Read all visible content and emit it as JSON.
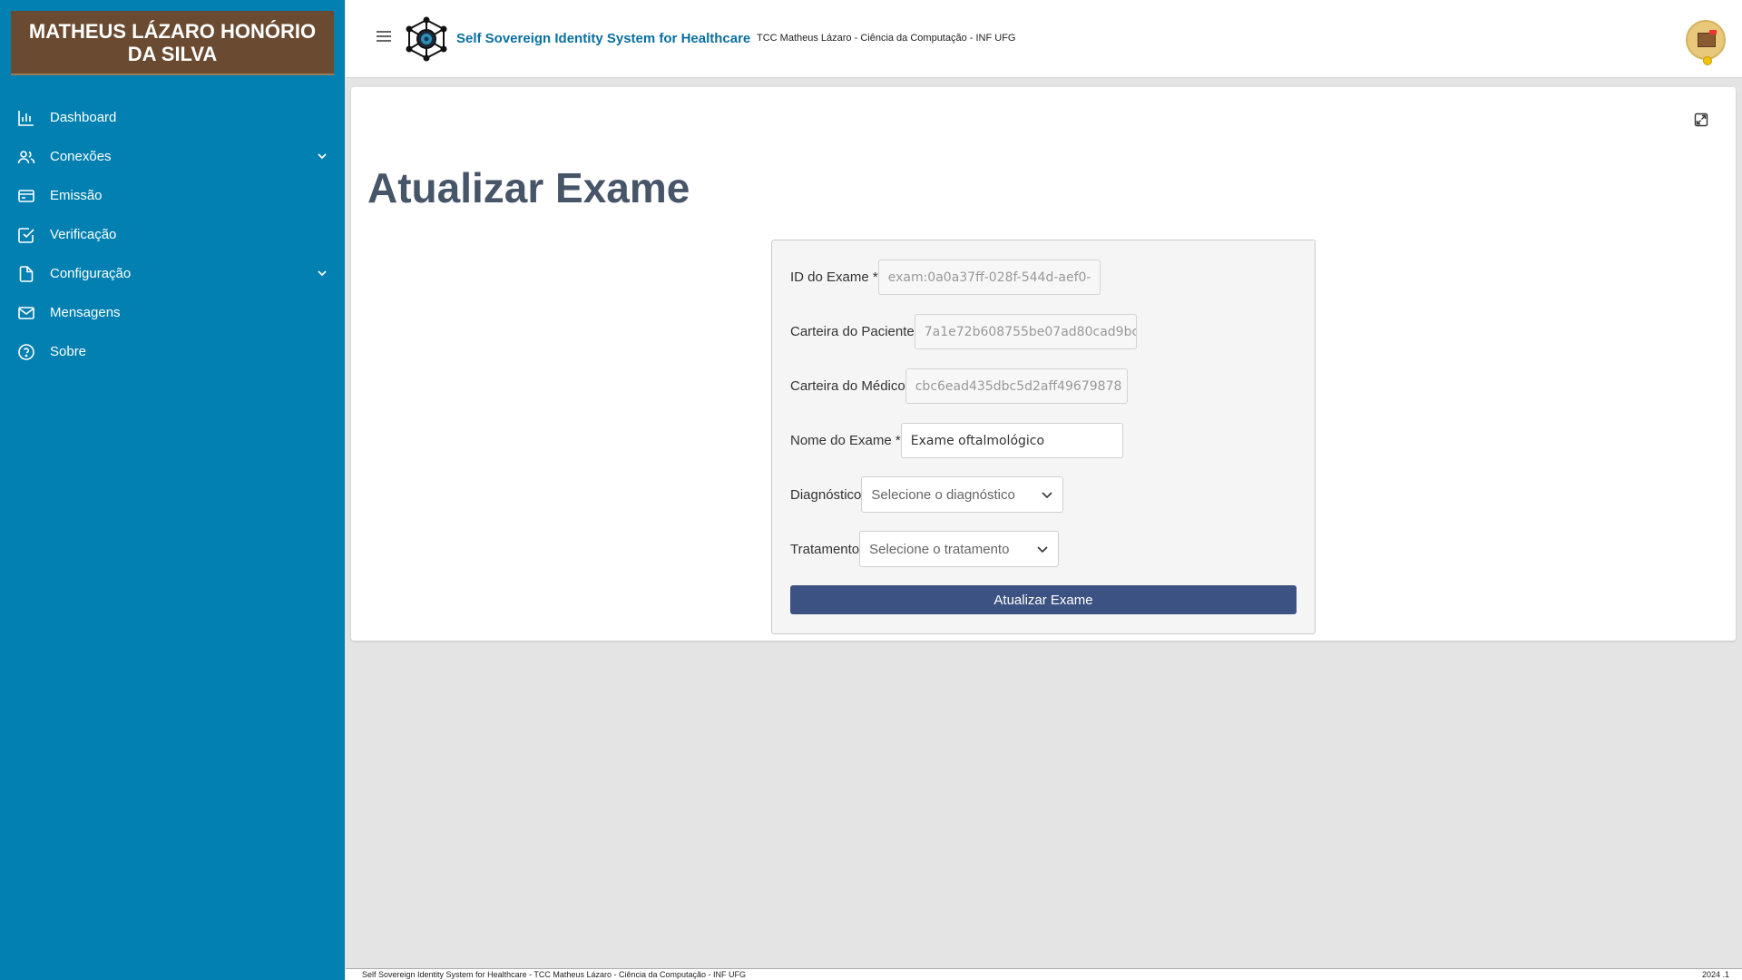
{
  "user": {
    "name": "MATHEUS LÁZARO HONÓRIO DA SILVA"
  },
  "sidebar": {
    "items": [
      {
        "label": "Dashboard",
        "icon": "bar-chart-icon"
      },
      {
        "label": "Conexões",
        "icon": "users-icon",
        "expandable": true
      },
      {
        "label": "Emissão",
        "icon": "credit-card-icon"
      },
      {
        "label": "Verificação",
        "icon": "check-square-icon"
      },
      {
        "label": "Configuração",
        "icon": "file-icon",
        "expandable": true
      },
      {
        "label": "Mensagens",
        "icon": "mail-icon"
      },
      {
        "label": "Sobre",
        "icon": "help-circle-icon"
      }
    ]
  },
  "header": {
    "app_title": "Self Sovereign Identity System for Healthcare",
    "subtitle": "TCC Matheus Lázaro - Ciência da Computação - INF UFG"
  },
  "page": {
    "title": "Atualizar Exame"
  },
  "form": {
    "exam_id_label": "ID do Exame *",
    "exam_id_value": "exam:0a0a37ff-028f-544d-aef0-",
    "patient_wallet_label": "Carteira do Paciente",
    "patient_wallet_value": "7a1e72b608755be07ad80cad9bc",
    "doctor_wallet_label": "Carteira do Médico",
    "doctor_wallet_value": "cbc6ead435dbc5d2aff49679878",
    "exam_name_label": "Nome do Exame *",
    "exam_name_value": "Exame oftalmológico",
    "diagnosis_label": "Diagnóstico",
    "diagnosis_placeholder": "Selecione o diagnóstico",
    "treatment_label": "Tratamento",
    "treatment_placeholder": "Selecione o tratamento",
    "submit_label": "Atualizar Exame"
  },
  "footer": {
    "left": "Self Sovereign Identity System for Healthcare - TCC Matheus Lázaro - Ciência da Computação - INF UFG",
    "right": "2024 .1"
  },
  "colors": {
    "sidebar_bg": "#0180b1",
    "user_banner_bg": "#6a4a30",
    "accent_title": "#0a6fa0",
    "button_bg": "#3c5282"
  }
}
